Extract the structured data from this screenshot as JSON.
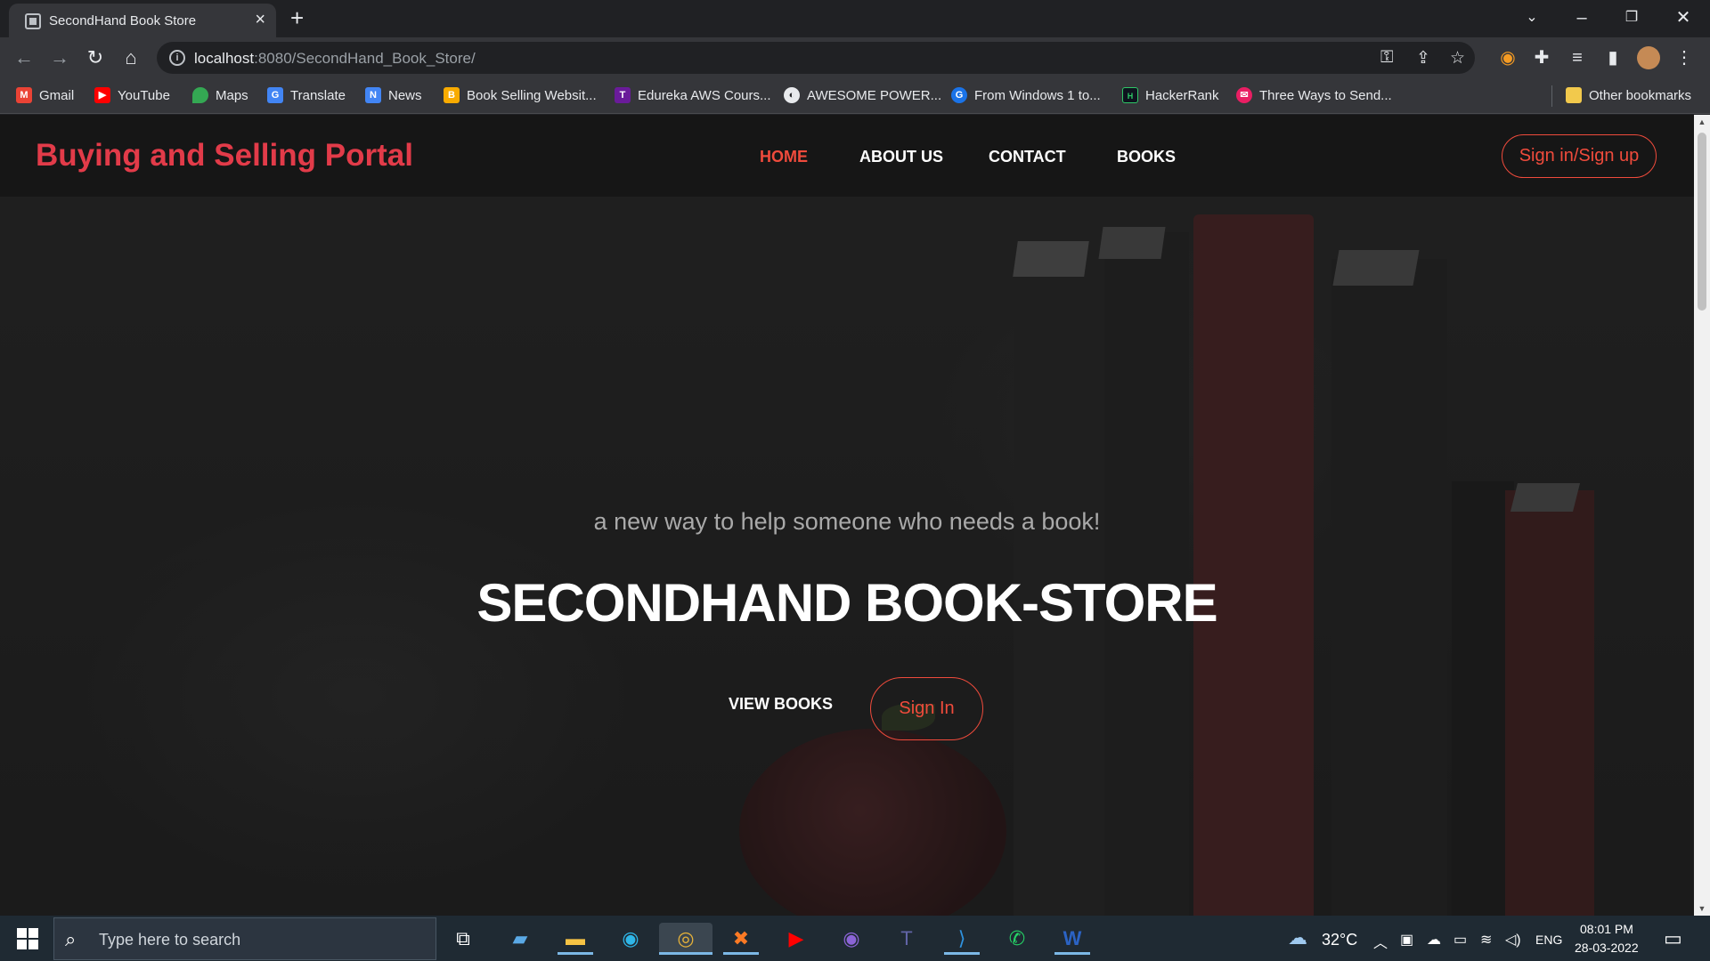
{
  "browser": {
    "tab_title": "SecondHand Book Store",
    "url_host": "localhost",
    "url_rest": ":8080/SecondHand_Book_Store/",
    "bookmarks": [
      {
        "label": "Gmail",
        "icon": "gmail-icon",
        "color": "#ea4335"
      },
      {
        "label": "YouTube",
        "icon": "youtube-icon",
        "color": "#ff0000"
      },
      {
        "label": "Maps",
        "icon": "maps-icon",
        "color": "#34a853"
      },
      {
        "label": "Translate",
        "icon": "translate-icon",
        "color": "#4285f4"
      },
      {
        "label": "News",
        "icon": "news-icon",
        "color": "#4285f4"
      },
      {
        "label": "Book Selling Websit...",
        "icon": "book-selling-icon",
        "color": "#f9ab00"
      },
      {
        "label": "Edureka AWS Cours...",
        "icon": "edureka-icon",
        "color": "#6a1b9a"
      },
      {
        "label": "AWESOME POWER...",
        "icon": "awesome-power-icon",
        "color": "#e8eaed"
      },
      {
        "label": "From Windows 1 to...",
        "icon": "windows-article-icon",
        "color": "#1a73e8"
      },
      {
        "label": "HackerRank",
        "icon": "hackerrank-icon",
        "color": "#2ec866"
      },
      {
        "label": "Three Ways to Send...",
        "icon": "three-ways-icon",
        "color": "#e91e63"
      }
    ],
    "other_bookmarks": "Other bookmarks"
  },
  "site": {
    "brand": "Buying and Selling Portal",
    "nav": [
      "HOME",
      "ABOUT US",
      "CONTACT",
      "BOOKS"
    ],
    "active_nav": "HOME",
    "signin_signup": "Sign in/Sign up",
    "tagline": "a new way to help someone who needs a book!",
    "headline": "SECONDHAND BOOK-STORE",
    "view_books": "VIEW BOOKS",
    "sign_in": "Sign In",
    "accent_color": "#f04b3c",
    "brand_color": "#e23b49"
  },
  "taskbar": {
    "search_placeholder": "Type here to search",
    "temperature": "32°C",
    "language": "ENG",
    "time": "08:01 PM",
    "date": "28-03-2022"
  }
}
